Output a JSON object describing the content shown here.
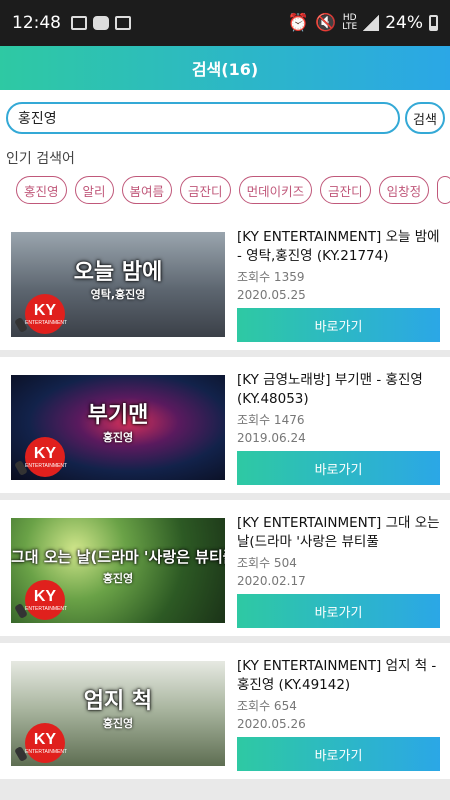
{
  "status_bar": {
    "time": "12:48",
    "battery": "24%",
    "network_top": "HD",
    "network_bottom": "LTE"
  },
  "header": {
    "title": "검색(16)"
  },
  "search": {
    "value": "홍진영",
    "button_label": "검색"
  },
  "popular": {
    "label": "인기 검색어",
    "chips": [
      "홍진영",
      "알리",
      "봄여름",
      "금잔디",
      "먼데이키즈",
      "금잔디",
      "임창정",
      ""
    ]
  },
  "results": [
    {
      "title": "[KY ENTERTAINMENT] 오늘 밤에 - 영탁,홍진영 (KY.21774)",
      "views": "조회수 1359",
      "date": "2020.05.25",
      "button": "바로가기",
      "thumb_title": "오늘 밤에",
      "thumb_singer": "영탁,홍진영",
      "thumb_colors": [
        "#7b8a97",
        "#4a5360"
      ]
    },
    {
      "title": "[KY 금영노래방] 부기맨 - 홍진영 (KY.48053)",
      "views": "조회수 1476",
      "date": "2019.06.24",
      "button": "바로가기",
      "thumb_title": "부기맨",
      "thumb_singer": "홍진영",
      "thumb_colors": [
        "#3a1a4a",
        "#0b1a3a"
      ]
    },
    {
      "title": "[KY ENTERTAINMENT] 그대 오는 날(드라마 '사랑은 뷰티풀",
      "views": "조회수 504",
      "date": "2020.02.17",
      "button": "바로가기",
      "thumb_title": "그대 오는 날(드라마 '사랑은 뷰티풀 인생..",
      "thumb_singer": "홍진영",
      "thumb_colors": [
        "#4f8a3a",
        "#9ac36a"
      ]
    },
    {
      "title": "[KY ENTERTAINMENT] 엄지 척 - 홍진영 (KY.49142)",
      "views": "조회수 654",
      "date": "2020.05.26",
      "button": "바로가기",
      "thumb_title": "엄지 척",
      "thumb_singer": "홍진영",
      "thumb_colors": [
        "#c9cfc4",
        "#6e7d64"
      ]
    }
  ],
  "logo": {
    "text": "KY",
    "sub": "ENTERTAINMENT",
    "color": "#e0201d"
  }
}
